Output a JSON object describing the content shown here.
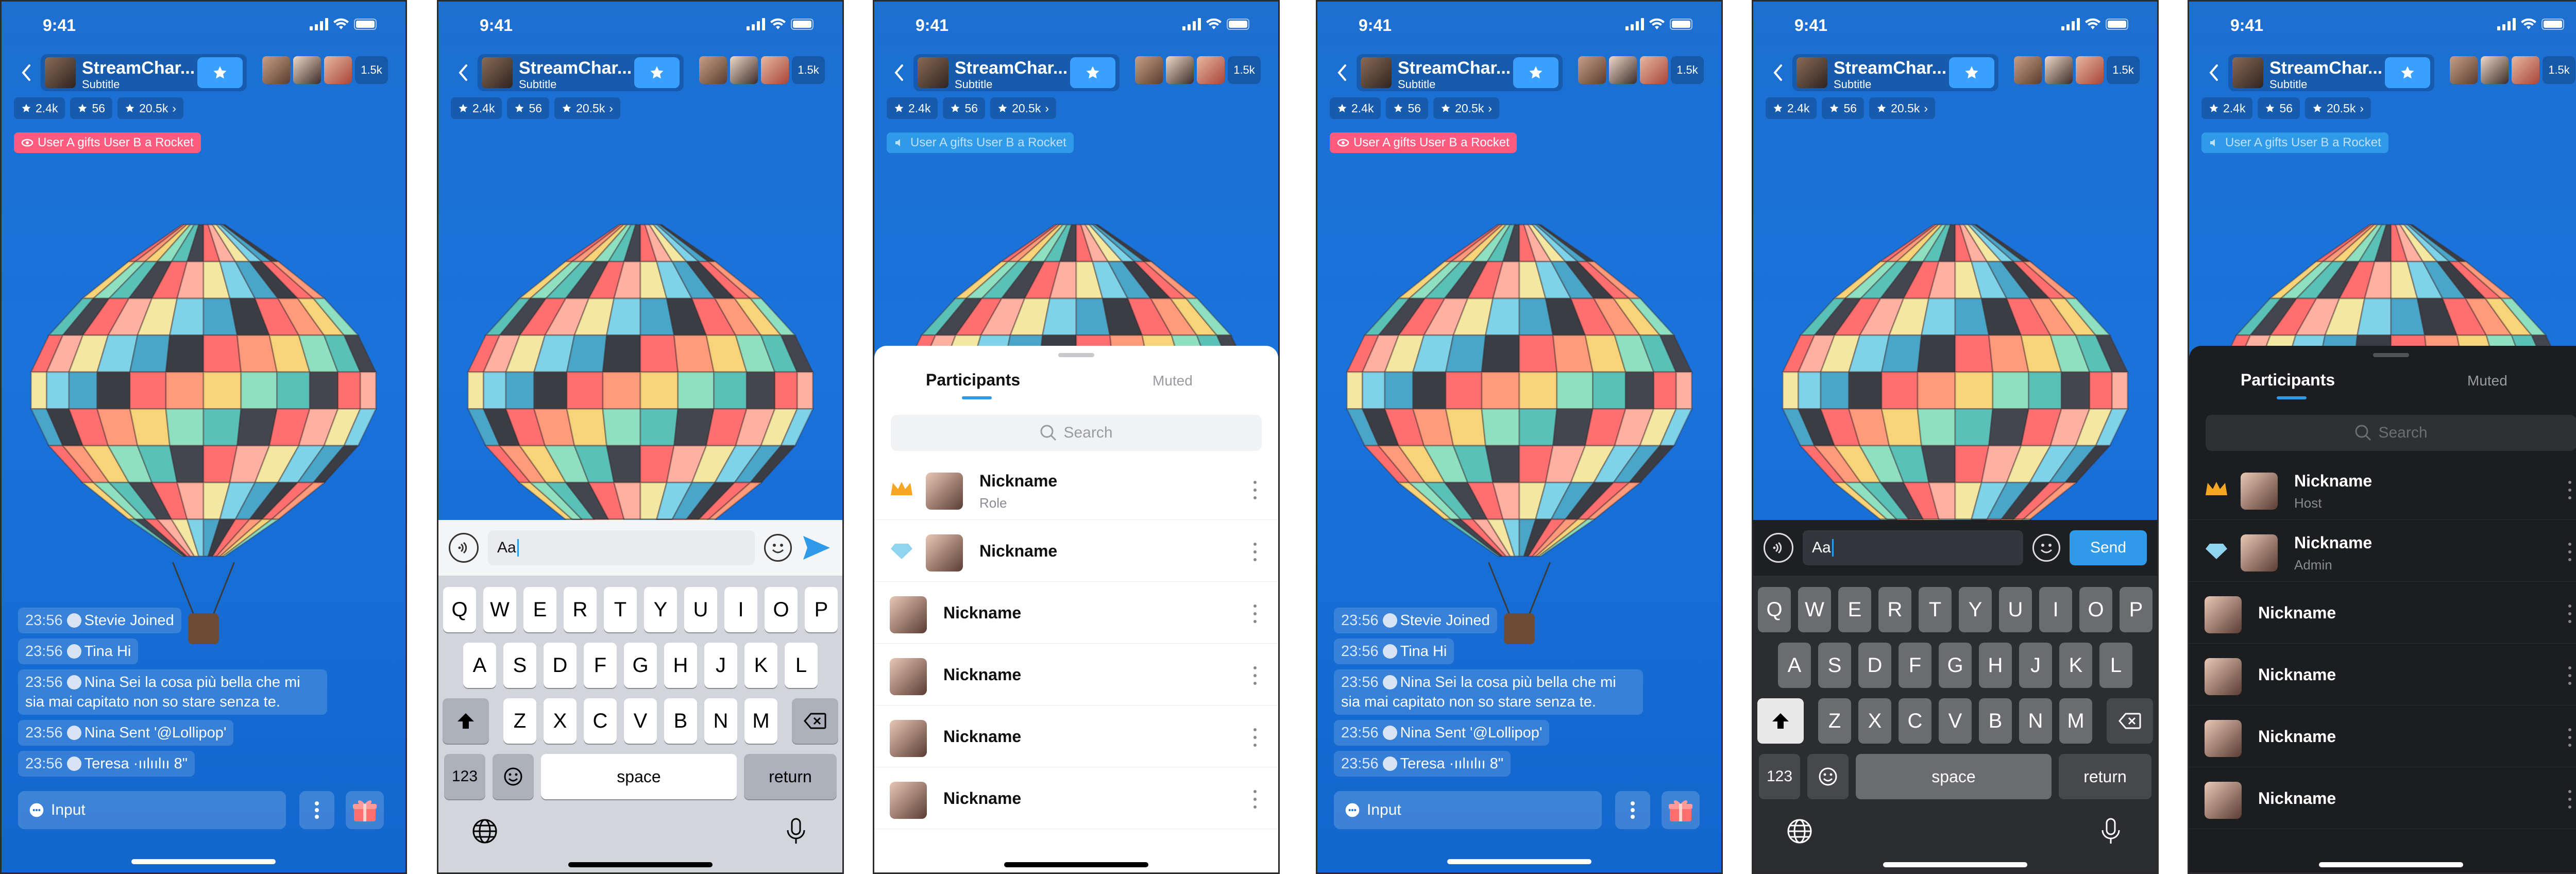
{
  "status": {
    "time": "9:41"
  },
  "header": {
    "host_name": "StreamChar...",
    "host_subtitle": "Subtitle",
    "viewer_count": "1.5k"
  },
  "stats": [
    {
      "icon": "star-icon",
      "value": "2.4k"
    },
    {
      "icon": "star-icon",
      "value": "56"
    },
    {
      "icon": "star-icon",
      "value": "20.5k",
      "chevron": "›"
    }
  ],
  "gift_banner": {
    "text": "User A gifts User B a Rocket",
    "color_red": "#ff5b7e",
    "color_blue": "#2f9be8"
  },
  "chat": [
    {
      "time": "23:56",
      "text": "Stevie Joined"
    },
    {
      "time": "23:56",
      "text": "Tina Hi"
    },
    {
      "time": "23:56",
      "text": "Nina Sei la cosa più bella che mi sia mai capitato non so stare senza te."
    },
    {
      "time": "23:56",
      "text": "Nina Sent '@Lollipop'"
    },
    {
      "time": "23:56",
      "text": "Teresa ·ıılıılıı 8\""
    }
  ],
  "bottom": {
    "input_placeholder": "Input"
  },
  "composer": {
    "value": "Aa",
    "send_label": "Send"
  },
  "keyboard": {
    "row1": [
      "Q",
      "W",
      "E",
      "R",
      "T",
      "Y",
      "U",
      "I",
      "O",
      "P"
    ],
    "row2": [
      "A",
      "S",
      "D",
      "F",
      "G",
      "H",
      "J",
      "K",
      "L"
    ],
    "row3": [
      "Z",
      "X",
      "C",
      "V",
      "B",
      "N",
      "M"
    ],
    "num_label": "123",
    "space_label": "space",
    "return_label": "return"
  },
  "sheet": {
    "tab_participants": "Participants",
    "tab_muted": "Muted",
    "search_placeholder": "Search",
    "light_rows": [
      {
        "badge": "crown",
        "name": "Nickname",
        "role": "Role"
      },
      {
        "badge": "diamond",
        "name": "Nickname",
        "role": ""
      },
      {
        "badge": "",
        "name": "Nickname",
        "role": ""
      },
      {
        "badge": "",
        "name": "Nickname",
        "role": ""
      },
      {
        "badge": "",
        "name": "Nickname",
        "role": ""
      },
      {
        "badge": "",
        "name": "Nickname",
        "role": ""
      }
    ],
    "dark_rows": [
      {
        "badge": "crown",
        "name": "Nickname",
        "role": "Host"
      },
      {
        "badge": "diamond",
        "name": "Nickname",
        "role": "Admin"
      },
      {
        "badge": "",
        "name": "Nickname",
        "role": ""
      },
      {
        "badge": "",
        "name": "Nickname",
        "role": ""
      },
      {
        "badge": "",
        "name": "Nickname",
        "role": ""
      },
      {
        "badge": "",
        "name": "Nickname",
        "role": ""
      }
    ]
  },
  "colors": {
    "accent": "#2f9be8",
    "gift_red": "#ff5b7e",
    "background_blue": "#1a6fd2"
  }
}
